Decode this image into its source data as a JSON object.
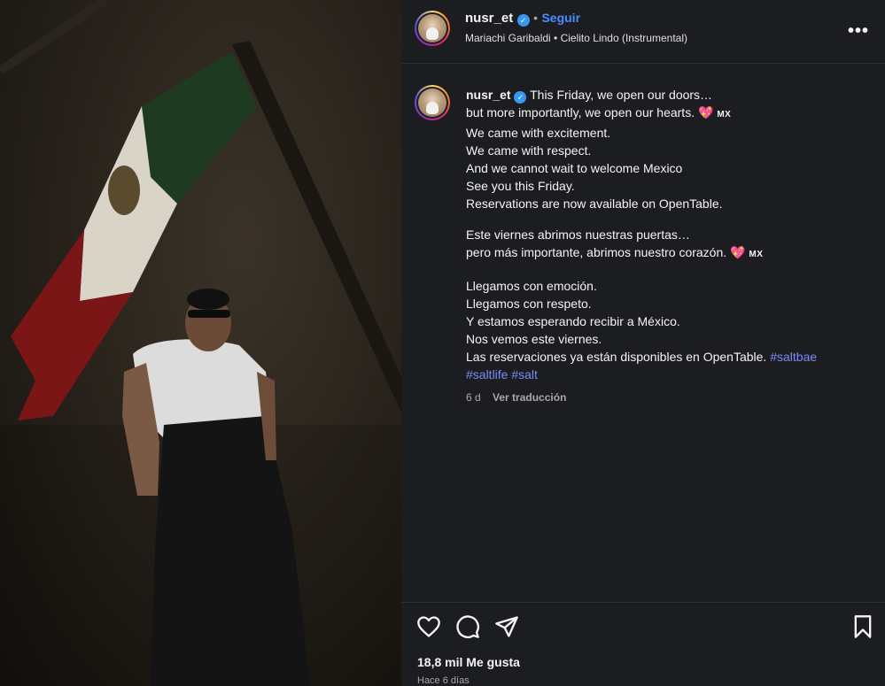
{
  "post": {
    "username": "nusr_et",
    "follow_label": "Seguir",
    "separator": "•",
    "music": {
      "artist": "Mariachi Garibaldi",
      "bullet": "•",
      "track": "Cielito Lindo (Instrumental)"
    },
    "more_icon": "more-horizontal-icon"
  },
  "caption": {
    "username": "nusr_et",
    "lines": [
      "This Friday, we open our doors…",
      "but more importantly, we open our hearts.",
      "We came with excitement.",
      "We came with respect.",
      "And we cannot wait to welcome Mexico",
      "See you this Friday.",
      "Reservations are now available on OpenTable.",
      "Este viernes abrimos nuestras puertas…",
      "pero más importante, abrimos nuestro corazón.",
      "Llegamos con emoción.",
      "Llegamos con respeto.",
      "Y estamos esperando recibir a México.",
      "Nos vemos este viernes.",
      "Las reservaciones ya están disponibles en OpenTable."
    ],
    "heart_emoji": "💖",
    "flag_text": "MX",
    "hashtags": [
      "#saltbae",
      "#saltlife",
      "#salt"
    ],
    "time": "6 d",
    "translate_label": "Ver traducción"
  },
  "actions": {
    "likes": "18,8 mil Me gusta",
    "posted_ago": "Hace 6 días"
  },
  "colors": {
    "panel_bg": "#1c1d21",
    "link_blue": "#4a8cff",
    "hashtag": "#7b8cf5",
    "verified": "#3897f0"
  }
}
